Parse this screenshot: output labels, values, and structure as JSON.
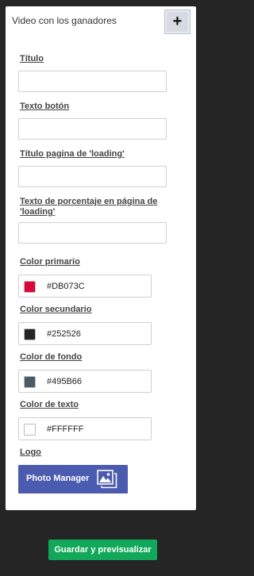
{
  "panel": {
    "title": "Video con los ganadores",
    "add_label": "+"
  },
  "fields": {
    "titulo": {
      "label": "Título",
      "value": ""
    },
    "texto_boton": {
      "label": "Texto botón",
      "value": ""
    },
    "titulo_loading": {
      "label": "Título pagina de 'loading'",
      "value": ""
    },
    "texto_porcentaje": {
      "label": "Texto de porcentaje en página de 'loading'",
      "value": ""
    }
  },
  "colors": {
    "primario": {
      "label": "Color primario",
      "value": "#DB073C",
      "swatch": "#DB073C"
    },
    "secundario": {
      "label": "Color secundario",
      "value": "#252526",
      "swatch": "#252526"
    },
    "fondo": {
      "label": "Color de fondo",
      "value": "#495B66",
      "swatch": "#495B66"
    },
    "texto": {
      "label": "Color de texto",
      "value": "#FFFFFF",
      "swatch": "#FFFFFF"
    }
  },
  "logo": {
    "label": "Logo",
    "button_label": "Photo Manager",
    "icon": "photo-gallery-icon"
  },
  "footer": {
    "save_label": "Guardar y previsualizar"
  },
  "theme": {
    "page_background": "#252526",
    "panel_background": "#FFFFFF",
    "photo_manager_color": "#4A5BB0",
    "save_button_color": "#12A85A"
  }
}
